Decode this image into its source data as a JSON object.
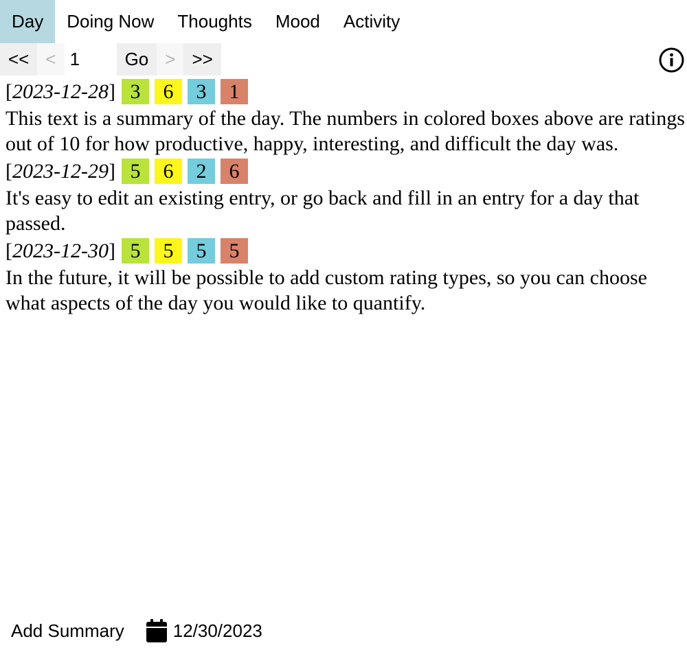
{
  "nav": {
    "tabs": [
      {
        "label": "Day",
        "active": true
      },
      {
        "label": "Doing Now",
        "active": false
      },
      {
        "label": "Thoughts",
        "active": false
      },
      {
        "label": "Mood",
        "active": false
      },
      {
        "label": "Activity",
        "active": false
      }
    ]
  },
  "pager": {
    "first": "<<",
    "prev": "<",
    "page": "1",
    "go": "Go",
    "next": ">",
    "last": ">>"
  },
  "info_icon": "info-circle-icon",
  "rating_colors": [
    "#b9e33b",
    "#fcf61b",
    "#74ccdc",
    "#d9826a"
  ],
  "entries": [
    {
      "date": "2023-12-28",
      "ratings": [
        "3",
        "6",
        "3",
        "1"
      ],
      "summary": "This text is a summary of the day. The numbers in colored boxes above are ratings out of 10 for how productive, happy, interesting, and difficult the day was."
    },
    {
      "date": "2023-12-29",
      "ratings": [
        "5",
        "6",
        "2",
        "6"
      ],
      "summary": "It's easy to edit an existing entry, or go back and fill in an entry for a day that passed."
    },
    {
      "date": "2023-12-30",
      "ratings": [
        "5",
        "5",
        "5",
        "5"
      ],
      "summary": "In the future, it will be possible to add custom rating types, so you can choose what aspects of the day you would like to quantify."
    }
  ],
  "bottom": {
    "add_summary": "Add Summary",
    "calendar_icon": "calendar-icon",
    "date": "12/30/2023"
  }
}
